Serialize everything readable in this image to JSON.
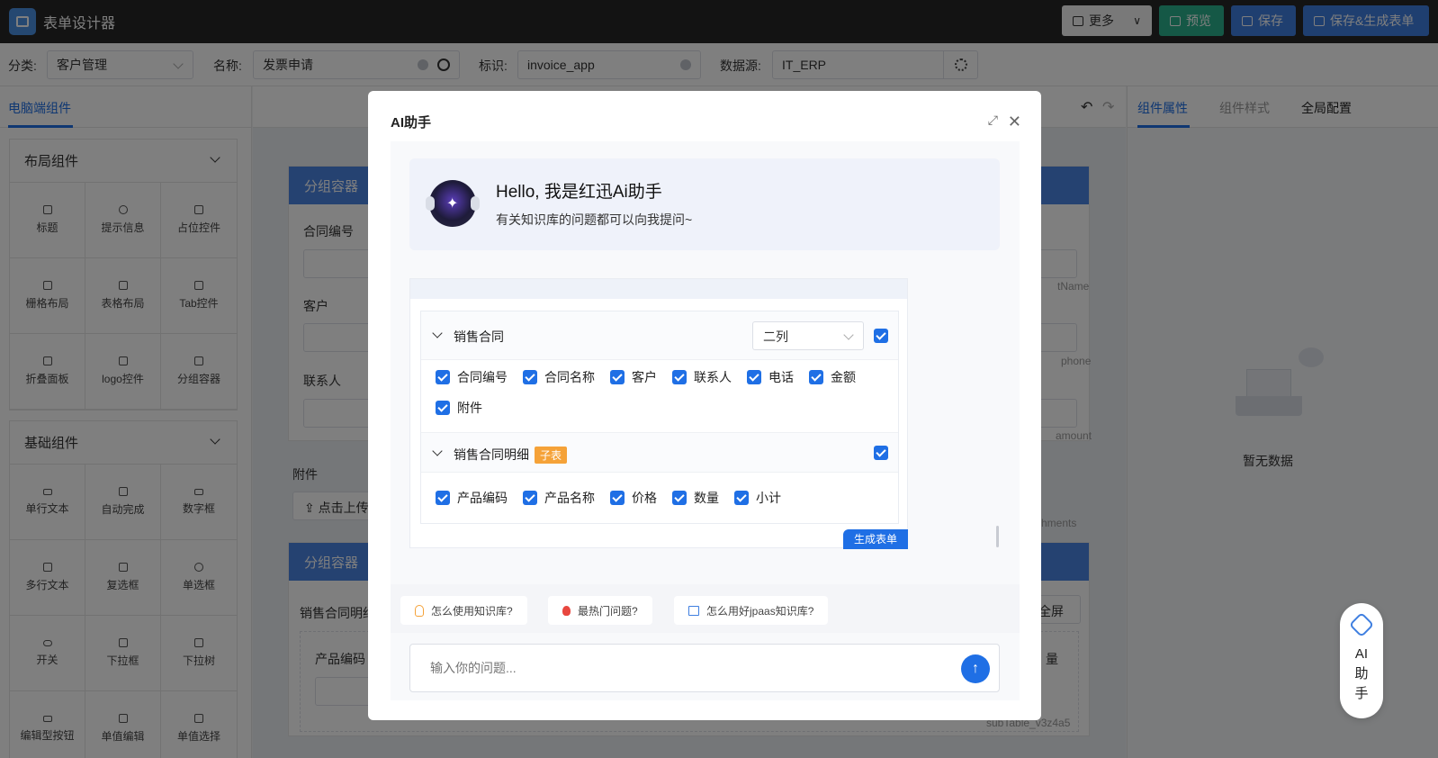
{
  "app": {
    "title": "表单设计器"
  },
  "top_actions": {
    "more": "更多",
    "preview": "预览",
    "save": "保存",
    "save_generate": "保存&生成表单"
  },
  "meta": {
    "category_label": "分类:",
    "category_value": "客户管理",
    "name_label": "名称:",
    "name_value": "发票申请",
    "id_label": "标识:",
    "id_value": "invoice_app",
    "datasource_label": "数据源:",
    "datasource_value": "IT_ERP"
  },
  "left_panel": {
    "title": "电脑端组件",
    "groups": [
      {
        "title": "布局组件",
        "items": [
          "标题",
          "提示信息",
          "占位控件",
          "栅格布局",
          "表格布局",
          "Tab控件",
          "折叠面板",
          "logo控件",
          "分组容器"
        ]
      },
      {
        "title": "基础组件",
        "items": [
          "单行文本",
          "自动完成",
          "数字框",
          "多行文本",
          "复选框",
          "单选框",
          "开关",
          "下拉框",
          "下拉树",
          "编辑型按钮",
          "单值编辑",
          "单值选择"
        ]
      }
    ]
  },
  "canvas": {
    "group1_title": "分组容器",
    "field_contract_no": "合同编号",
    "field_customer": "客户",
    "field_contact": "联系人",
    "field_attachment": "附件",
    "upload_label": "点击上传",
    "group2_title": "分组容器",
    "detail_label": "销售合同明细",
    "product_code_label": "产品编码",
    "ghost_name": "tName",
    "ghost_phone": "phone",
    "ghost_amount": "amount",
    "ghost_attachments": "chments",
    "fullscreen": "全屏",
    "qty": "量",
    "subtable_id": "subTable_v3z4a5"
  },
  "right_panel": {
    "tabs": [
      "组件属性",
      "组件样式",
      "全局配置"
    ],
    "empty": "暂无数据"
  },
  "ai_float": {
    "chars": [
      "AI",
      "助",
      "手"
    ]
  },
  "modal": {
    "title": "AI助手",
    "hello_title": "Hello, 我是红迅Ai助手",
    "hello_sub": "有关知识库的问题都可以向我提问~",
    "section1": {
      "title": "销售合同",
      "columns": "二列",
      "fields": [
        "合同编号",
        "合同名称",
        "客户",
        "联系人",
        "电话",
        "金额",
        "附件"
      ]
    },
    "section2": {
      "title": "销售合同明细",
      "badge": "子表",
      "fields": [
        "产品编码",
        "产品名称",
        "价格",
        "数量",
        "小计"
      ]
    },
    "generate_button": "生成表单",
    "suggestions": [
      "怎么使用知识库?",
      "最热门问题?",
      "怎么用好jpaas知识库?"
    ],
    "input_placeholder": "输入你的问题..."
  },
  "colors": {
    "primary": "#1f6fe5",
    "header": "#262626",
    "preview_green": "#2bb08c",
    "badge_orange": "#f5a238"
  }
}
